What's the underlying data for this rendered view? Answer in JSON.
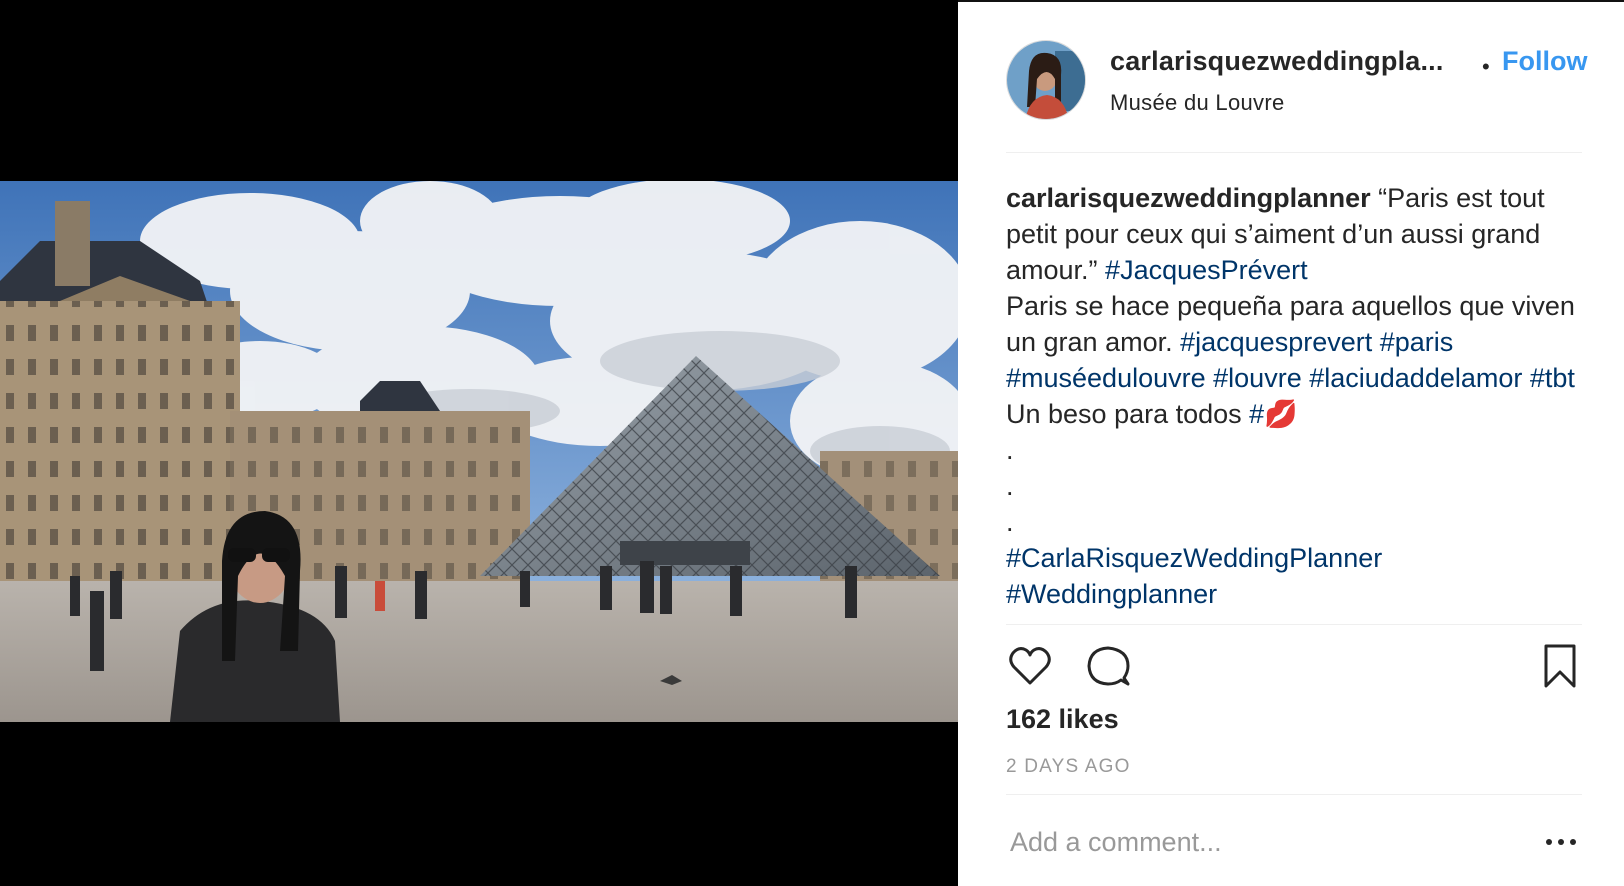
{
  "post": {
    "username": "carlarisquezweddingpla...",
    "follow_label": "Follow",
    "separator": "•",
    "location": "Musée du Louvre"
  },
  "caption": {
    "username": "carlarisquezweddingplanner",
    "text_1": " “Paris est tout petit pour ceux qui s’aiment d’un aussi grand amour.” ",
    "tag_1": "#JacquesPrévert",
    "text_2": "Paris se hace pequeña para aquellos que viven un gran amor. ",
    "tag_2": "#jacquesprevert",
    "tag_3": "#paris",
    "tag_4": "#muséedulouvre",
    "tag_5": "#louvre",
    "tag_6": "#laciudaddelamor",
    "tag_7": "#tbt",
    "text_3": " Un beso para todos ",
    "tag_8": "#💋",
    "dot": ".",
    "tag_9": "#CarlaRisquezWeddingPlanner",
    "tag_10": "#Weddingplanner"
  },
  "stats": {
    "likes": "162 likes",
    "time_ago": "2 DAYS AGO"
  },
  "comment": {
    "placeholder": "Add a comment..."
  },
  "icons": {
    "like": "heart-icon",
    "comment": "comment-bubble-icon",
    "save": "bookmark-icon",
    "more": "more-options-icon"
  },
  "colors": {
    "link": "#3897f0",
    "hashtag": "#003569",
    "text": "#262626",
    "muted": "#999999"
  }
}
